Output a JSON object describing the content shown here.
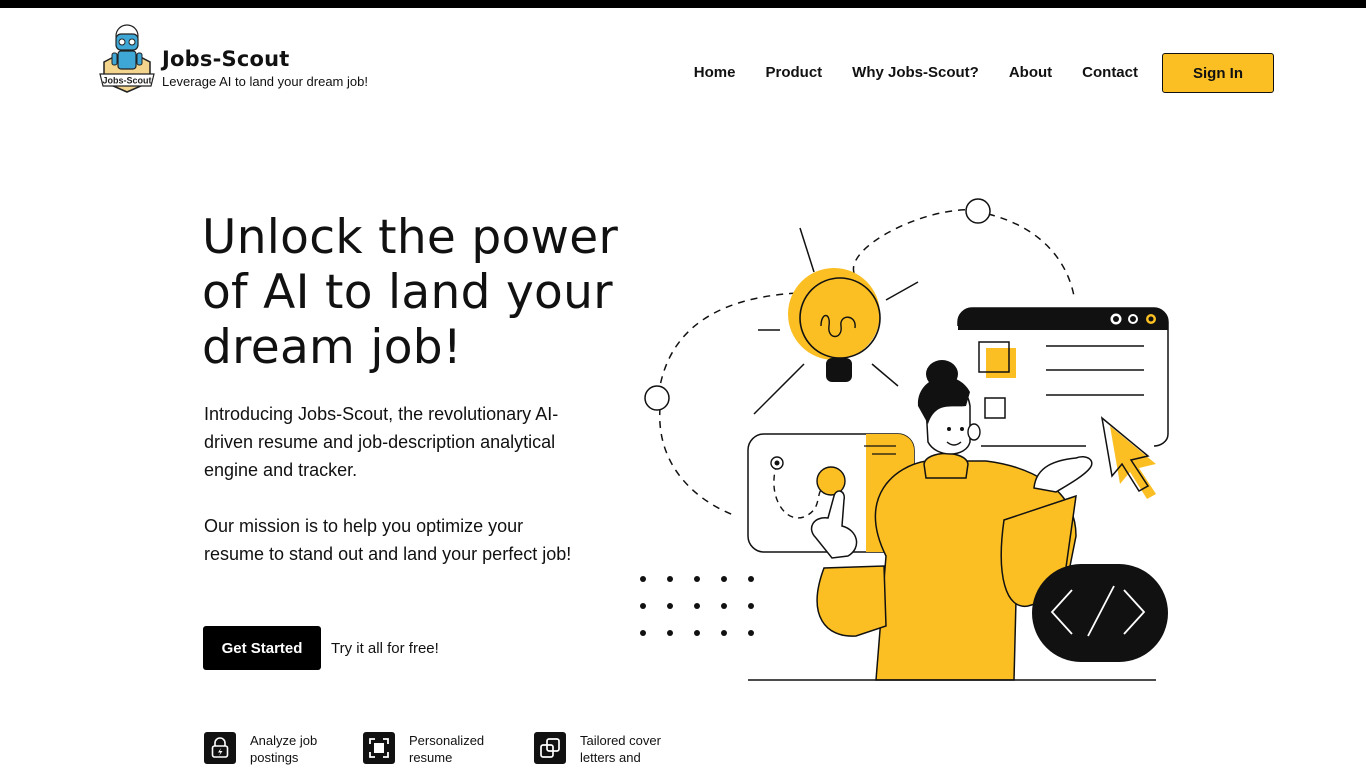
{
  "brand": {
    "logo_text": "Jobs-Scout",
    "title": "Jobs-Scout",
    "tagline": "Leverage AI to land your dream job!"
  },
  "nav": {
    "items": [
      "Home",
      "Product",
      "Why Jobs-Scout?",
      "About",
      "Contact"
    ],
    "signin_label": "Sign In"
  },
  "hero": {
    "title_lines": [
      "Unlock the power",
      "of AI to land your",
      "dream job!"
    ],
    "intro": "Introducing Jobs-Scout, the revolutionary AI-driven resume and job-description analytical engine and tracker.",
    "mission": "Our mission is to help you optimize your resume to stand out and land your perfect job!",
    "cta_label": "Get Started",
    "cta_note": "Try it all for free!"
  },
  "features": [
    {
      "icon": "lock-bolt-icon",
      "text": "Analyze job postings"
    },
    {
      "icon": "frame-icon",
      "text": "Personalized resume"
    },
    {
      "icon": "layers-icon",
      "text": "Tailored cover letters and"
    }
  ],
  "colors": {
    "accent": "#fbbf24",
    "dark": "#111111",
    "background": "#ffffff"
  }
}
